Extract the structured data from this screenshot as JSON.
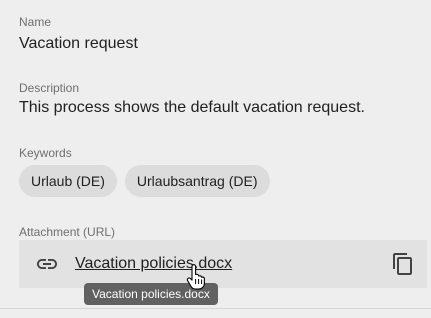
{
  "name": {
    "label": "Name",
    "value": "Vacation request"
  },
  "description": {
    "label": "Description",
    "value": "This process shows the default vacation request."
  },
  "keywords": {
    "label": "Keywords",
    "items": [
      "Urlaub (DE)",
      "Urlaubsantrag (DE)"
    ]
  },
  "attachment": {
    "label": "Attachment (URL)",
    "link_text": "Vacation policies.docx",
    "tooltip": "Vacation policies.docx",
    "icon": "link-icon",
    "action_icon": "copy-icon"
  }
}
